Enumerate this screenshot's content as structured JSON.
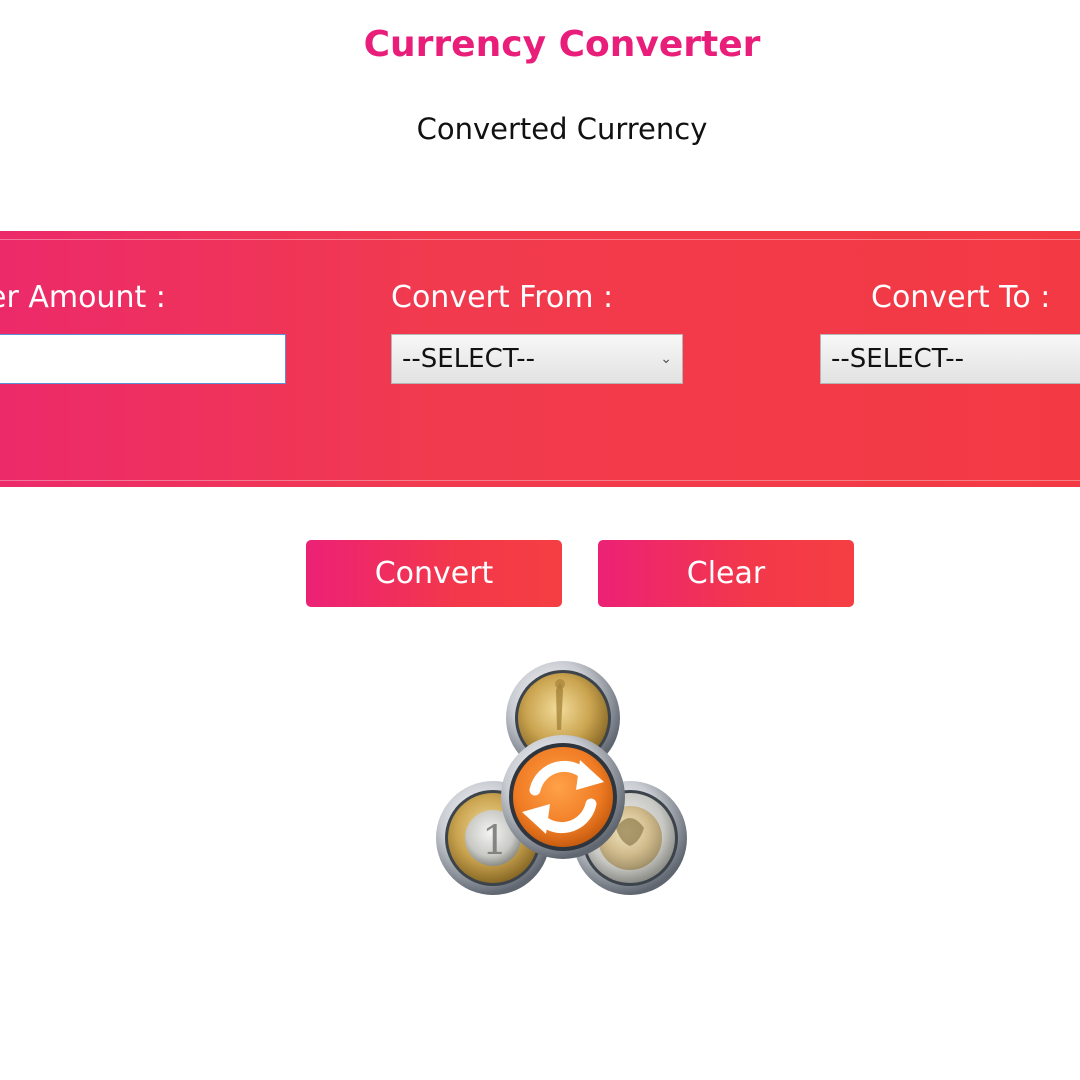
{
  "header": {
    "title": "Currency Converter",
    "subtitle": "Converted Currency"
  },
  "form": {
    "amount_label": "er Amount :",
    "amount_value": "",
    "from_label": "Convert From :",
    "from_selected": "--SELECT--",
    "to_label": "Convert To :",
    "to_selected": "--SELECT--"
  },
  "actions": {
    "convert_label": "Convert",
    "clear_label": "Clear"
  },
  "logo": {
    "icon": "coins-exchange-icon"
  },
  "colors": {
    "title": "#e91e7a",
    "panel_start": "#ec2a6a",
    "panel_end": "#f33a44",
    "exchange_orange": "#f07c24"
  }
}
